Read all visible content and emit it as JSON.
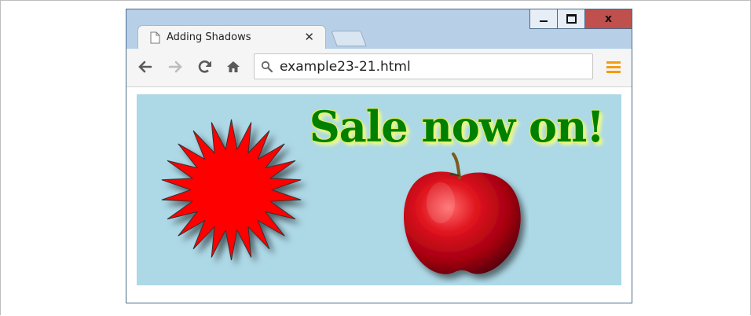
{
  "browser": {
    "tab": {
      "title": "Adding Shadows",
      "close_label": "✕"
    },
    "window_controls": {
      "close_label": "x"
    },
    "omnibox": {
      "url": "example23-21.html"
    }
  },
  "canvas": {
    "headline": "Sale now on!",
    "background_color": "#add8e6",
    "headline_color": "#008000",
    "starburst_color": "#ff0000"
  },
  "icons": [
    "page-icon",
    "back-arrow-icon",
    "forward-arrow-icon",
    "reload-icon",
    "home-icon",
    "search-icon",
    "menu-icon",
    "minimize-icon",
    "maximize-icon",
    "close-icon",
    "starburst-shape",
    "apple-image"
  ]
}
